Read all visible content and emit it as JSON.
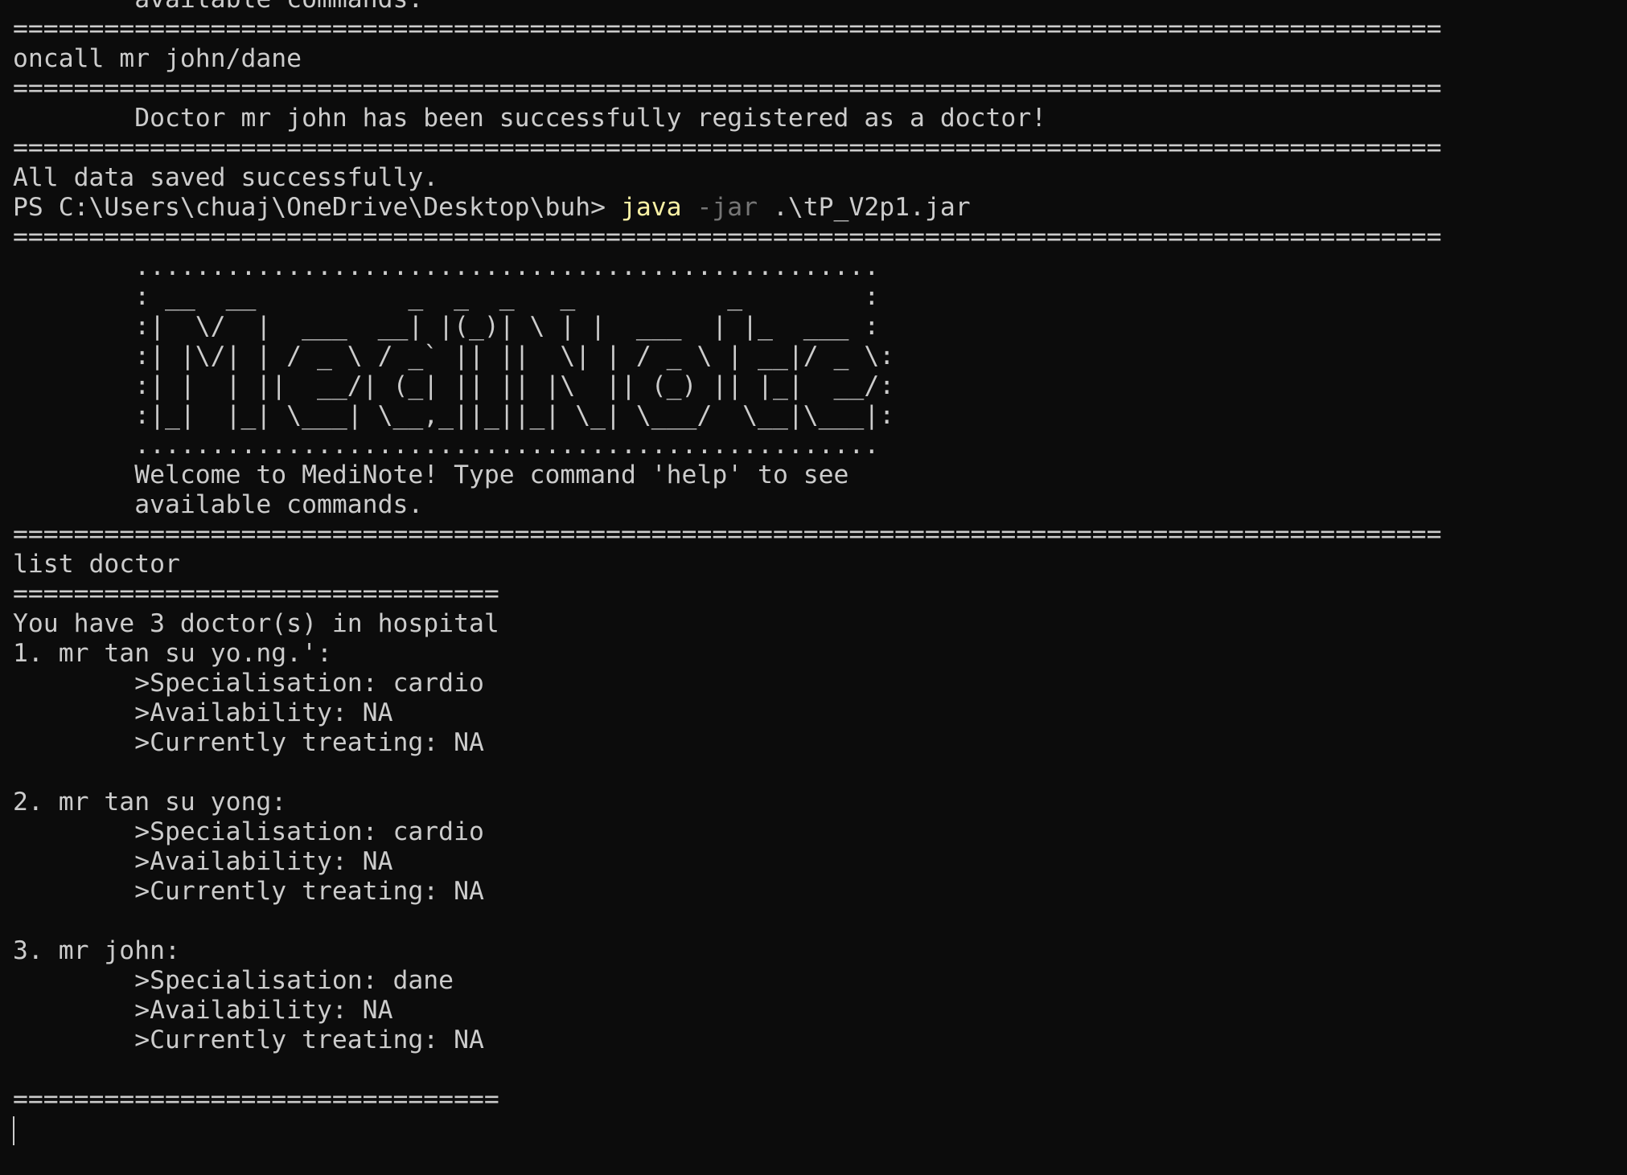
{
  "terminal": {
    "colors": {
      "background": "#0c0c0c",
      "foreground": "#cccccc",
      "command": "#f9f1a5",
      "parameter": "#767676"
    },
    "lines": [
      "        available commands.",
      "==============================================================================================",
      "oncall mr john/dane",
      "==============================================================================================",
      "        Doctor mr john has been successfully registered as a doctor!",
      "==============================================================================================",
      "All data saved successfully."
    ],
    "prompt": {
      "ps_path": "PS C:\\Users\\chuaj\\OneDrive\\Desktop\\buh> ",
      "command": "java",
      "flag": " -jar",
      "argument": " .\\tP_V2p1.jar"
    },
    "output_lines": [
      "==============================================================================================",
      "        .................................................",
      "        : __  __          _  _  _   _          _        :",
      "        :|  \\/  |  ___  __| |(_)| \\ | |  ___  | |_  ___ :",
      "        :| |\\/| | / _ \\ / _` || ||  \\| | / _ \\ | __|/ _ \\:",
      "        :| |  | ||  __/| (_| || || |\\  || (_) || |_|  __/:",
      "        :|_|  |_| \\___| \\__,_||_||_| \\_| \\___/  \\__|\\___|:",
      "        .................................................",
      "        Welcome to MediNote! Type command 'help' to see",
      "        available commands.",
      "==============================================================================================",
      "list doctor",
      "================================",
      "You have 3 doctor(s) in hospital",
      "1. mr tan su yo.ng.':",
      "        >Specialisation: cardio",
      "        >Availability: NA",
      "        >Currently treating: NA",
      "",
      "2. mr tan su yong:",
      "        >Specialisation: cardio",
      "        >Availability: NA",
      "        >Currently treating: NA",
      "",
      "3. mr john:",
      "        >Specialisation: dane",
      "        >Availability: NA",
      "        >Currently treating: NA",
      "",
      "================================"
    ]
  }
}
